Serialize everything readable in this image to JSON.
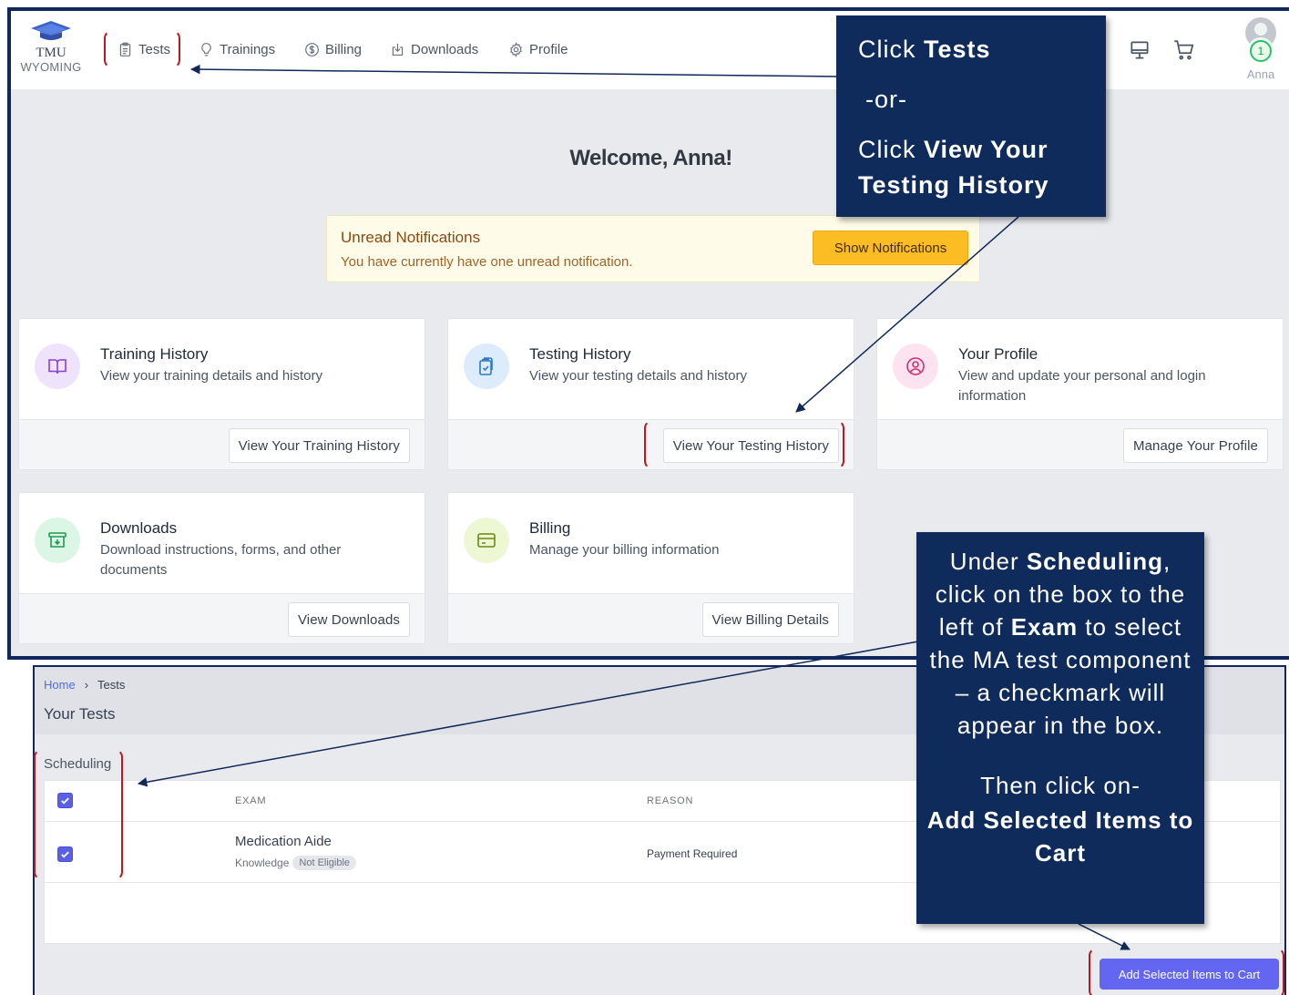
{
  "brand": {
    "line1": "TMU",
    "line2": "WYOMING"
  },
  "nav": {
    "items": [
      {
        "label": "Tests",
        "icon": "clipboard-icon"
      },
      {
        "label": "Trainings",
        "icon": "lightbulb-icon"
      },
      {
        "label": "Billing",
        "icon": "dollar-icon"
      },
      {
        "label": "Downloads",
        "icon": "download-icon"
      },
      {
        "label": "Profile",
        "icon": "gear-icon"
      }
    ],
    "right_icons": [
      "monitor-icon",
      "cart-icon"
    ],
    "user": {
      "name": "Anna",
      "badge_count": "1"
    }
  },
  "welcome": "Welcome, Anna!",
  "notifications": {
    "title": "Unread Notifications",
    "text": "You have currently have one unread notification.",
    "button": "Show Notifications"
  },
  "cards": [
    {
      "title": "Training History",
      "desc": "View your training details and history",
      "button": "View Your Training History",
      "icon": "book-icon",
      "icon_bg": "#efe2fb",
      "icon_color": "#8b3fd6"
    },
    {
      "title": "Testing History",
      "desc": "View your testing details and history",
      "button": "View Your Testing History",
      "icon": "clipboard-check-icon",
      "icon_bg": "#dcecfb",
      "icon_color": "#2e79c7"
    },
    {
      "title": "Your Profile",
      "desc": "View and update your personal and login information",
      "button": "Manage Your Profile",
      "icon": "user-circle-icon",
      "icon_bg": "#fde3ef",
      "icon_color": "#d1306e"
    },
    {
      "title": "Downloads",
      "desc": "Download instructions, forms, and other documents",
      "button": "View Downloads",
      "icon": "archive-icon",
      "icon_bg": "#dbf6e4",
      "icon_color": "#1f9a55"
    },
    {
      "title": "Billing",
      "desc": "Manage your billing information",
      "button": "View Billing Details",
      "icon": "credit-card-icon",
      "icon_bg": "#eef7d4",
      "icon_color": "#6a8a12"
    }
  ],
  "tests": {
    "breadcrumb": {
      "home": "Home",
      "current": "Tests"
    },
    "title": "Your Tests",
    "section": "Scheduling",
    "columns": {
      "exam": "EXAM",
      "reason": "REASON"
    },
    "rows": [
      {
        "exam": "Medication Aide",
        "type": "Knowledge",
        "status": "Not Eligible",
        "reason": "Payment Required",
        "checked": true
      }
    ],
    "add_button": "Add Selected Items to Cart"
  },
  "callouts": {
    "one": {
      "line1_pre": "Click ",
      "line1_bold": "Tests",
      "line2": "-or-",
      "line3_pre": "Click ",
      "line3_bold": "View Your Testing History"
    },
    "two": {
      "p1_pre": "Under ",
      "p1_bold1": "Scheduling",
      "p1_mid": ", click on the box to the left of ",
      "p1_bold2": "Exam",
      "p1_post": " to select the MA test component – a checkmark will appear in the box.",
      "p2_pre": "Then click on-",
      "p2_bold": "Add Selected Items to Cart"
    }
  },
  "colors": {
    "callout_bg": "#0f2b5b",
    "bracket": "#c0161f",
    "primary": "#6366f1",
    "warning": "#fbbd23"
  }
}
